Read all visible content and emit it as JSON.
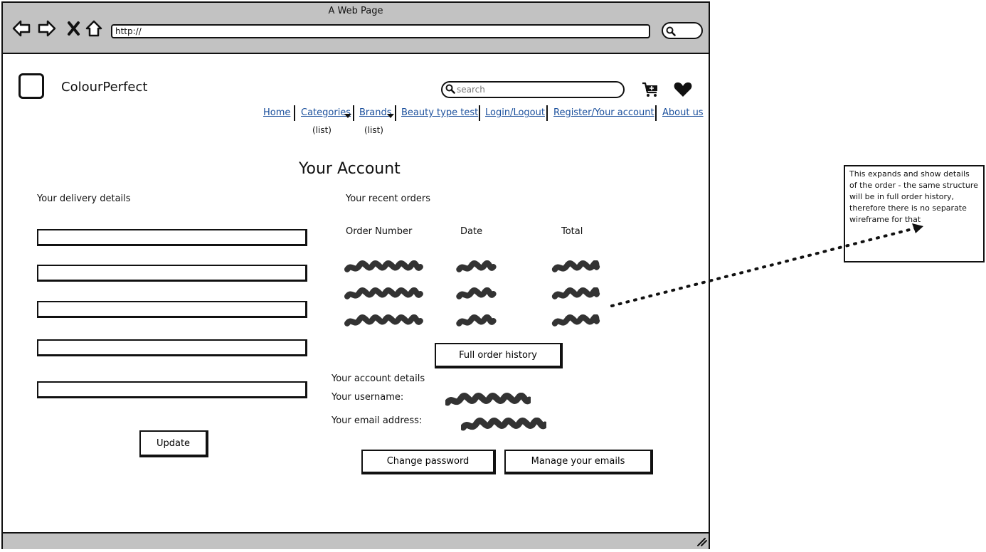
{
  "window": {
    "title": "A Web Page",
    "url": "http://"
  },
  "site": {
    "brand": "ColourPerfect",
    "search_placeholder": "search"
  },
  "menu": {
    "home": "Home",
    "categories": "Categories",
    "categories_sub": "(list)",
    "brands": "Brands",
    "brands_sub": "(list)",
    "beauty": "Beauty type test",
    "login": "Login/Logout",
    "register": "Register/Your account",
    "about": "About us"
  },
  "page": {
    "heading": "Your Account"
  },
  "delivery": {
    "label": "Your delivery details",
    "update_label": "Update"
  },
  "orders": {
    "label": "Your recent orders",
    "columns": [
      "Order Number",
      "Date",
      "Total"
    ],
    "history_label": "Full order history"
  },
  "account": {
    "label": "Your account details",
    "username_label": "Your username:",
    "email_label": "Your email address:",
    "change_password_label": "Change password",
    "manage_emails_label": "Manage your emails"
  },
  "annotation": {
    "text": "This expands and show details of the order - the same structure will be in full order history, therefore there is no separate wireframe for that"
  },
  "colors": {
    "chrome": "#c2c2c2",
    "link": "#1a4f9c",
    "ink": "#111111"
  }
}
